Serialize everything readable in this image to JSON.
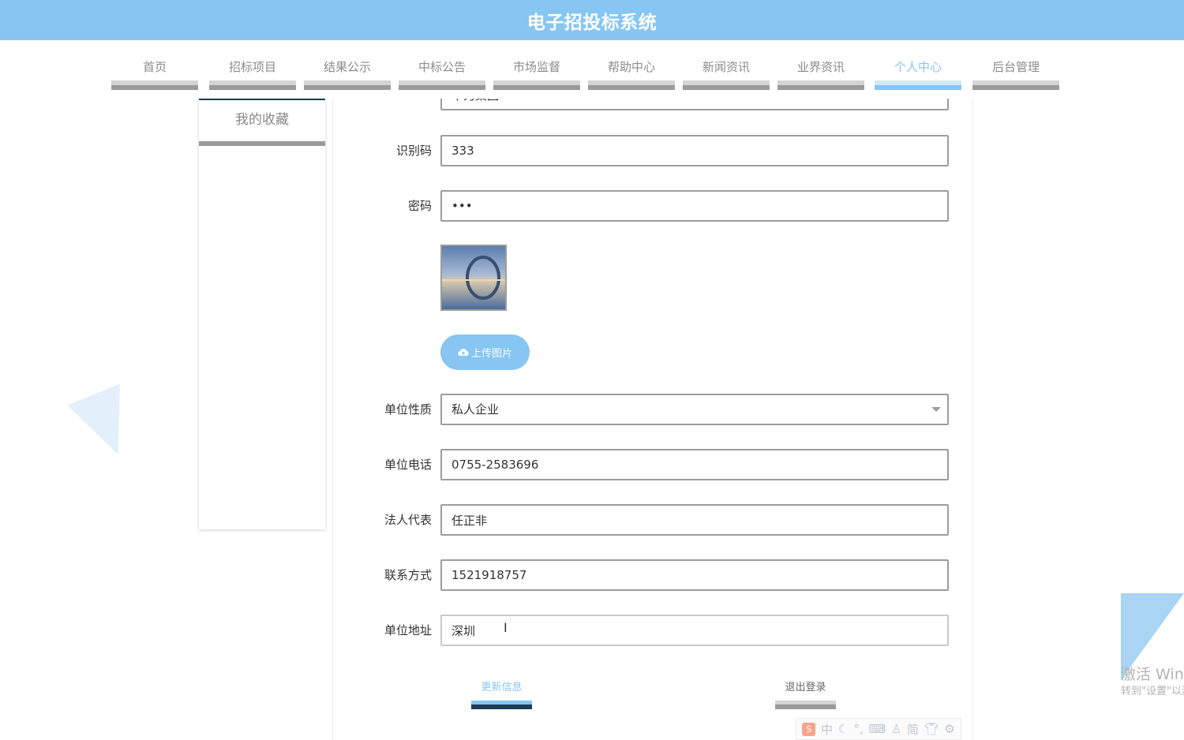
{
  "app": {
    "title": "电子招投标系统"
  },
  "nav": {
    "items": [
      {
        "label": "首页"
      },
      {
        "label": "招标项目"
      },
      {
        "label": "结果公示"
      },
      {
        "label": "中标公告"
      },
      {
        "label": "市场监督"
      },
      {
        "label": "帮助中心"
      },
      {
        "label": "新闻资讯"
      },
      {
        "label": "业界资讯"
      },
      {
        "label": "个人中心",
        "active": true
      },
      {
        "label": "后台管理"
      }
    ]
  },
  "sidebar": {
    "items": [
      {
        "label": "我的收藏"
      }
    ]
  },
  "form": {
    "unit_name": {
      "value": "华为集团"
    },
    "id_code": {
      "label": "识别码",
      "value": "333"
    },
    "password": {
      "label": "密码",
      "value": "•••"
    },
    "upload_label": "上传图片",
    "unit_type": {
      "label": "单位性质",
      "value": "私人企业"
    },
    "unit_phone": {
      "label": "单位电话",
      "value": "0755-2583696"
    },
    "legal_rep": {
      "label": "法人代表",
      "value": "任正非"
    },
    "contact": {
      "label": "联系方式",
      "value": "1521918757"
    },
    "address": {
      "label": "单位地址",
      "value": "深圳"
    },
    "update_label": "更新信息",
    "logout_label": "退出登录"
  },
  "watermark": {
    "line1": "激活 Windows",
    "line2": "转到\"设置\"以激活 Windows。"
  },
  "ime": {
    "items": [
      "中",
      "简"
    ]
  },
  "colors": {
    "accent": "#87c5f2",
    "nav_inactive_bar": "#9a9a9a",
    "dark_navy": "#1d3d55"
  }
}
